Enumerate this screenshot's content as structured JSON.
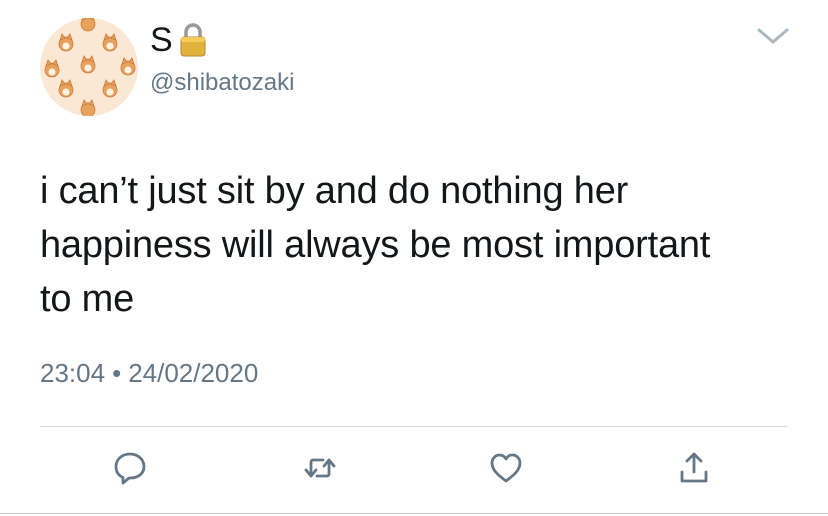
{
  "author": {
    "display_name": "S",
    "handle": "@shibatozaki",
    "protected_icon": "lock-icon",
    "avatar_icon": "shiba-pattern-avatar"
  },
  "tweet": {
    "line1": "i can’t just sit by and do nothing her",
    "line2": "happiness will always be most important",
    "line3": "to me"
  },
  "meta": {
    "time": "23:04",
    "separator": "•",
    "date": "24/02/2020"
  },
  "actions": [
    {
      "name": "reply",
      "icon": "reply-icon"
    },
    {
      "name": "retweet",
      "icon": "retweet-icon"
    },
    {
      "name": "like",
      "icon": "heart-icon"
    },
    {
      "name": "share",
      "icon": "share-icon"
    }
  ],
  "colors": {
    "text_primary": "#14171a",
    "text_secondary": "#657786",
    "icon_gray": "#657786",
    "avatar_bg": "#fbe8d4",
    "shiba_orange": "#e8a25e"
  }
}
